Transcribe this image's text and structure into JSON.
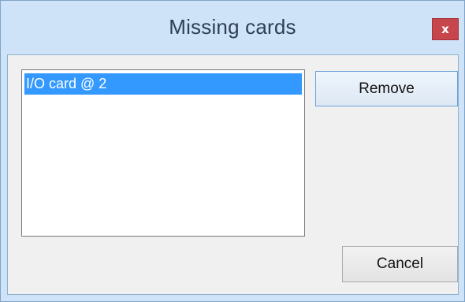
{
  "window": {
    "title": "Missing cards",
    "close_glyph": "x"
  },
  "list": {
    "items": [
      {
        "label": "I/O card @ 2",
        "selected": true
      }
    ]
  },
  "buttons": {
    "remove_label": "Remove",
    "cancel_label": "Cancel"
  },
  "colors": {
    "selection": "#3399ff",
    "close_button": "#c7464c",
    "frame": "#cfe3f8"
  }
}
